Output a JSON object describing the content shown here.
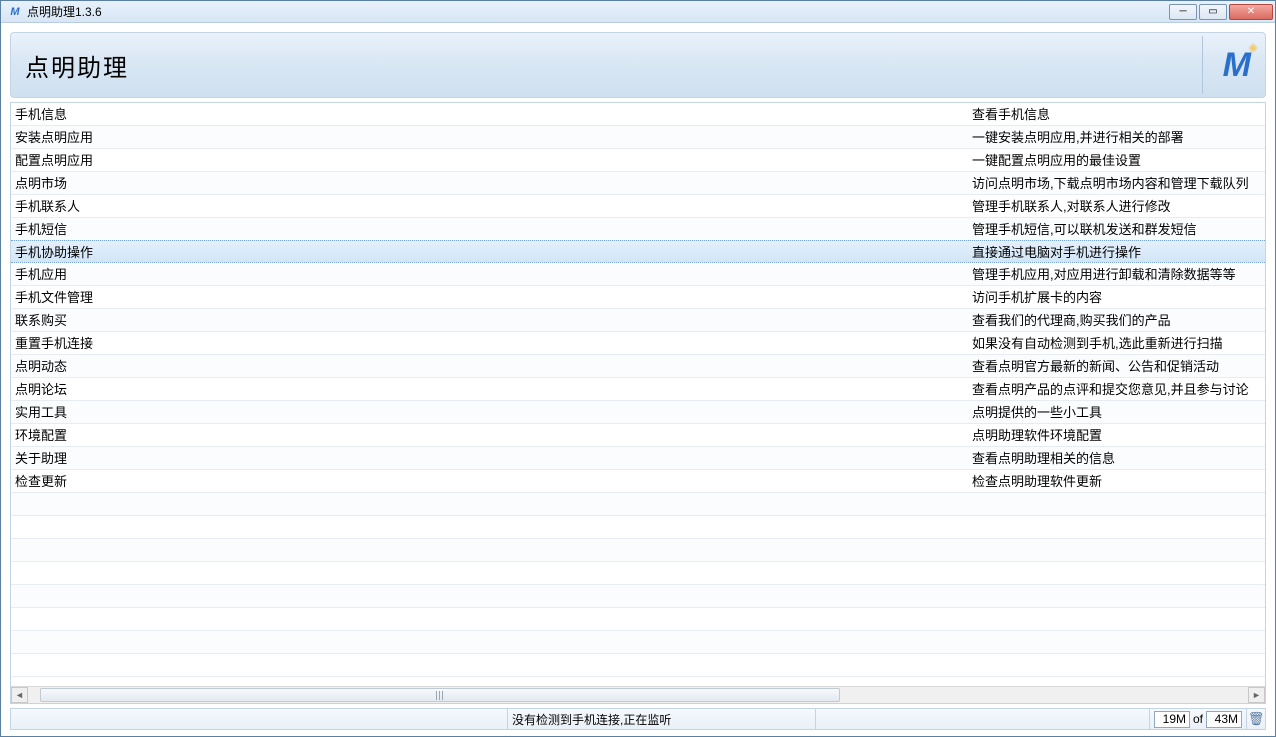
{
  "window": {
    "title": "点明助理1.3.6"
  },
  "header": {
    "title": "点明助理",
    "logo_text": "M"
  },
  "rows": [
    {
      "name": "手机信息",
      "desc": "查看手机信息"
    },
    {
      "name": "安装点明应用",
      "desc": "一键安装点明应用,并进行相关的部署"
    },
    {
      "name": "配置点明应用",
      "desc": "一键配置点明应用的最佳设置"
    },
    {
      "name": "点明市场",
      "desc": "访问点明市场,下载点明市场内容和管理下载队列"
    },
    {
      "name": "手机联系人",
      "desc": "管理手机联系人,对联系人进行修改"
    },
    {
      "name": "手机短信",
      "desc": "管理手机短信,可以联机发送和群发短信"
    },
    {
      "name": "手机协助操作",
      "desc": "直接通过电脑对手机进行操作",
      "selected": true
    },
    {
      "name": "手机应用",
      "desc": "管理手机应用,对应用进行卸载和清除数据等等"
    },
    {
      "name": "手机文件管理",
      "desc": "访问手机扩展卡的内容"
    },
    {
      "name": "联系购买",
      "desc": "查看我们的代理商,购买我们的产品"
    },
    {
      "name": "重置手机连接",
      "desc": "如果没有自动检测到手机,选此重新进行扫描"
    },
    {
      "name": "点明动态",
      "desc": "查看点明官方最新的新闻、公告和促销活动"
    },
    {
      "name": "点明论坛",
      "desc": "查看点明产品的点评和提交您意见,并且参与讨论"
    },
    {
      "name": "实用工具",
      "desc": "点明提供的一些小工具"
    },
    {
      "name": "环境配置",
      "desc": "点明助理软件环境配置"
    },
    {
      "name": "关于助理",
      "desc": "查看点明助理相关的信息"
    },
    {
      "name": "检查更新",
      "desc": "检查点明助理软件更新"
    }
  ],
  "status": {
    "message": "没有检测到手机连接,正在监听",
    "mem_used": "19M",
    "mem_of": "of",
    "mem_total": "43M"
  }
}
